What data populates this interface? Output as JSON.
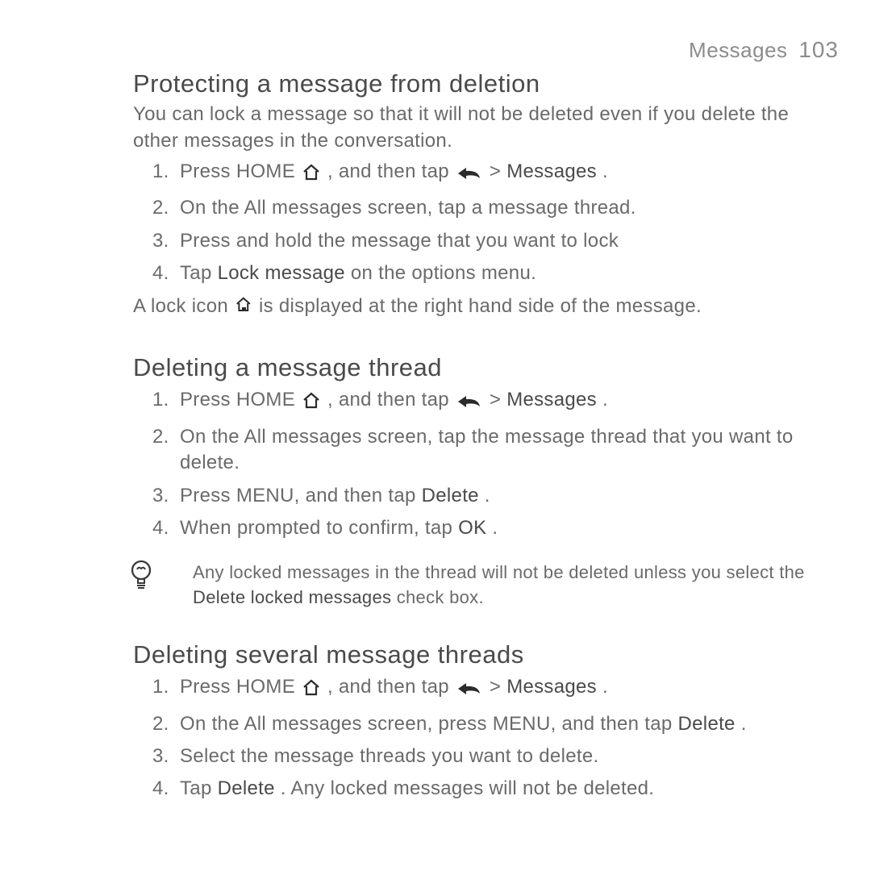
{
  "header": {
    "section": "Messages",
    "page": "103"
  },
  "sections": [
    {
      "title": "Protecting a message from deletion",
      "intro": "You can lock a message so that it will not be deleted even if you delete the other messages in the conversation.",
      "steps": [
        {
          "pre": "Press HOME ",
          "mid": ", and then tap ",
          "post1": "  > ",
          "bold1": "Messages",
          "post2": "."
        },
        {
          "text": "On the All messages screen, tap a message thread."
        },
        {
          "text": "Press and hold the message that you want to lock"
        },
        {
          "pre": "Tap ",
          "bold1": "Lock message",
          "post1": " on the options menu."
        }
      ],
      "after_pre": "A lock icon ",
      "after_post": " is displayed at the right hand side of the message."
    },
    {
      "title": "Deleting a message thread",
      "steps": [
        {
          "pre": "Press HOME ",
          "mid": ", and then tap ",
          "post1": "  > ",
          "bold1": "Messages",
          "post2": "."
        },
        {
          "text": "On the All messages screen, tap the message thread that you want to delete."
        },
        {
          "pre": "Press MENU, and then tap ",
          "bold1": "Delete",
          "post1": "."
        },
        {
          "pre": "When prompted to confirm, tap ",
          "bold1": "OK",
          "post1": "."
        }
      ],
      "tip_pre": "Any locked messages in the thread will not be deleted unless you select the ",
      "tip_bold": "Delete locked messages",
      "tip_post": " check box."
    },
    {
      "title": "Deleting several message threads",
      "steps": [
        {
          "pre": "Press HOME ",
          "mid": ", and then tap ",
          "post1": "  > ",
          "bold1": "Messages",
          "post2": "."
        },
        {
          "pre": "On the All messages screen, press MENU, and then tap ",
          "bold1": "Delete",
          "post1": "."
        },
        {
          "text": "Select the message threads you want to delete."
        },
        {
          "pre": "Tap ",
          "bold1": "Delete",
          "post1": ". Any locked messages will not be deleted."
        }
      ]
    }
  ]
}
